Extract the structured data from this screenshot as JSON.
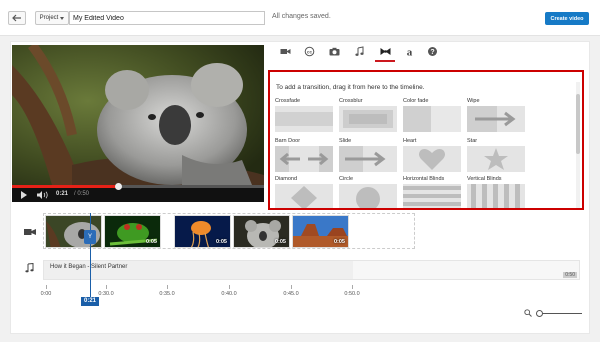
{
  "topbar": {
    "back_icon": "back-arrow-icon",
    "project_label": "Project",
    "title_value": "My Edited Video",
    "save_status": "All changes saved.",
    "create_label": "Create video"
  },
  "player": {
    "current_time": "0:21",
    "duration": "/ 0:50",
    "progress_fraction": 0.42
  },
  "tabs": [
    {
      "name": "video-clips",
      "icon": "video-camera-icon"
    },
    {
      "name": "creative-commons",
      "icon": "creative-commons-icon"
    },
    {
      "name": "photos",
      "icon": "camera-icon"
    },
    {
      "name": "audio",
      "icon": "music-note-icon"
    },
    {
      "name": "transitions",
      "icon": "bowtie-icon",
      "active": true
    },
    {
      "name": "text",
      "icon": "text-a-icon"
    },
    {
      "name": "help",
      "icon": "help-icon"
    }
  ],
  "transitions": {
    "header": "To add a transition, drag it from here to the timeline.",
    "items": [
      {
        "label": "Crossfade"
      },
      {
        "label": "Crossblur"
      },
      {
        "label": "Color fade"
      },
      {
        "label": "Wipe"
      },
      {
        "label": "Barn Door"
      },
      {
        "label": "Slide"
      },
      {
        "label": "Heart"
      },
      {
        "label": "Star"
      },
      {
        "label": "Diamond"
      },
      {
        "label": "Circle"
      },
      {
        "label": "Horizontal Blinds"
      },
      {
        "label": "Vertical Blinds"
      }
    ]
  },
  "timeline": {
    "clips": [
      {
        "duration": ""
      },
      {
        "duration": "0:05"
      },
      {
        "duration": "0:05"
      },
      {
        "duration": "0:05"
      },
      {
        "duration": "0:05"
      },
      {
        "duration": "0:05"
      }
    ],
    "transition_marker": "Y",
    "audio_label": "How it Began - Silent Partner",
    "audio_end": "0:50",
    "ruler": [
      "0:00",
      "0:30.0",
      "0:35.0",
      "0:40.0",
      "0:45.0",
      "0:50.0"
    ],
    "playhead_time": "0:21"
  },
  "colors": {
    "accent_blue": "#167ac6",
    "highlight_red": "#cc0000",
    "progress_red": "#e62117"
  }
}
